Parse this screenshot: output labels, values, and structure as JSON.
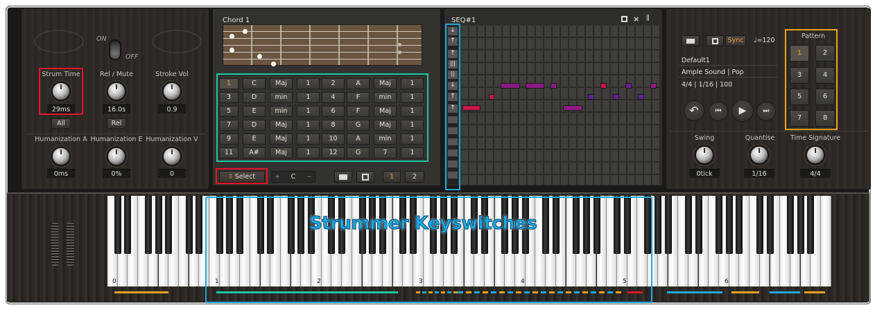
{
  "left": {
    "on_label": "ON",
    "off_label": "OFF",
    "knobs": [
      {
        "label": "Strum Time",
        "value": "29ms"
      },
      {
        "label": "Rel / Mute",
        "value": "16.0s"
      },
      {
        "label": "Stroke Vol",
        "value": "0.9"
      },
      {
        "label": "Humanization A",
        "value": "0ms"
      },
      {
        "label": "Humanization E",
        "value": "0%"
      },
      {
        "label": "Humanization V",
        "value": "0"
      }
    ],
    "all_label": "All",
    "rel_label": "Rel"
  },
  "chord": {
    "title": "Chord 1",
    "rows": [
      [
        "1",
        "C",
        "Maj",
        "1",
        "2",
        "A",
        "Maj",
        "1"
      ],
      [
        "3",
        "D",
        "min",
        "1",
        "4",
        "F",
        "min",
        "1"
      ],
      [
        "5",
        "E",
        "min",
        "1",
        "6",
        "F",
        "Maj",
        "1"
      ],
      [
        "7",
        "D",
        "Maj",
        "1",
        "8",
        "G",
        "Maj",
        "1"
      ],
      [
        "9",
        "E",
        "Maj",
        "1",
        "10",
        "A",
        "min",
        "1"
      ],
      [
        "11",
        "A#",
        "Maj",
        "1",
        "12",
        "G",
        "7",
        "1"
      ]
    ],
    "select_label": "Select",
    "plus": "+",
    "key": "C",
    "minus": "−",
    "page1": "1",
    "page2": "2"
  },
  "seq": {
    "title": "SEQ#1",
    "icons": [
      "copy-icon",
      "close-icon",
      "bars-icon"
    ],
    "strum_symbols": [
      "↓",
      "↑",
      "↑",
      "|||",
      "||",
      "↓",
      "↑",
      "↑"
    ]
  },
  "right": {
    "sync_label": "Sync",
    "tempo": "♩=120",
    "preset": "Default1",
    "library": "Ample Sound | Pop",
    "meter": "4/4 | 1/16 | 100",
    "pattern_title": "Pattern",
    "patterns": [
      "1",
      "2",
      "3",
      "4",
      "5",
      "6",
      "7",
      "8"
    ],
    "knobs": [
      {
        "label": "Swing",
        "value": "0tick"
      },
      {
        "label": "Quantise",
        "value": "1/16"
      },
      {
        "label": "Time Signature",
        "value": "4/4"
      }
    ]
  },
  "keyboard": {
    "overlay_title": "Strummer Keyswitches",
    "octaves": [
      "0",
      "1",
      "2",
      "3",
      "4",
      "5",
      "6"
    ]
  }
}
